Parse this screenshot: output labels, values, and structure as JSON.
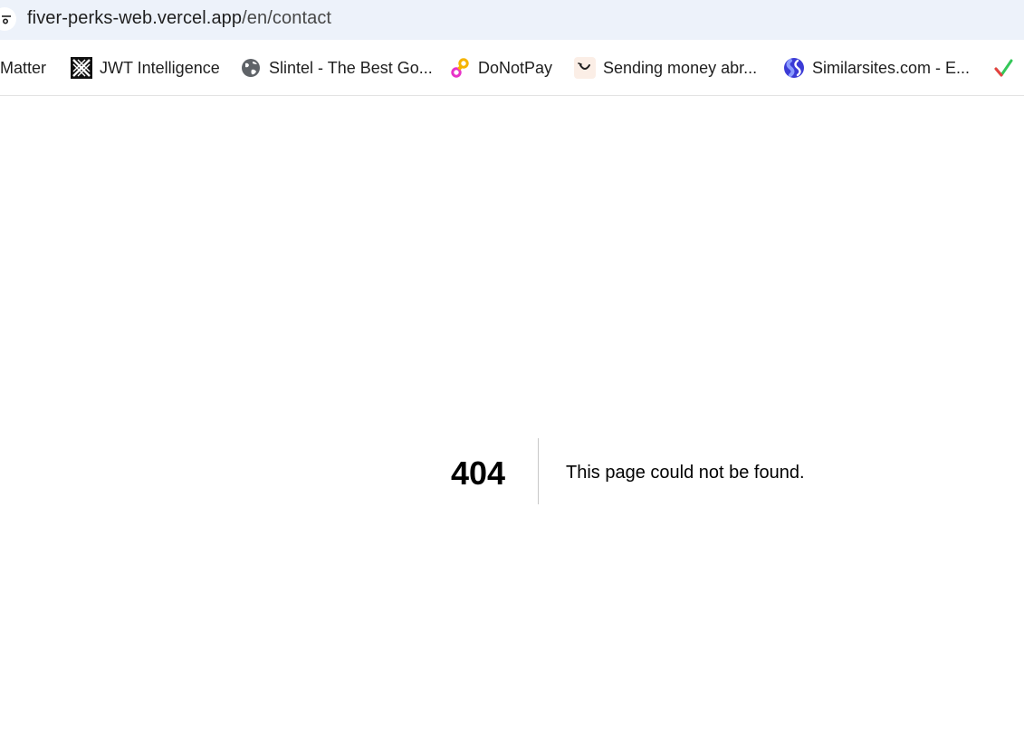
{
  "address_bar": {
    "host": "fiver-perks-web.vercel.app",
    "path": "/en/contact"
  },
  "bookmarks": [
    {
      "label": "Matter",
      "icon": "none"
    },
    {
      "label": "JWT Intelligence",
      "icon": "jwt-logo-icon"
    },
    {
      "label": "Slintel - The Best Go...",
      "icon": "globe-icon"
    },
    {
      "label": "DoNotPay",
      "icon": "donotpay-logo-icon"
    },
    {
      "label": "Sending money abr...",
      "icon": "smile-icon"
    },
    {
      "label": "Similarsites.com - E...",
      "icon": "similarsites-logo-icon"
    },
    {
      "label": "",
      "icon": "checkmark-icon"
    }
  ],
  "error": {
    "code": "404",
    "message": "This page could not be found."
  },
  "colors": {
    "toolbar_bg": "#edf2fa",
    "text": "#1f1f1f",
    "divider": "#c8c8c8"
  }
}
